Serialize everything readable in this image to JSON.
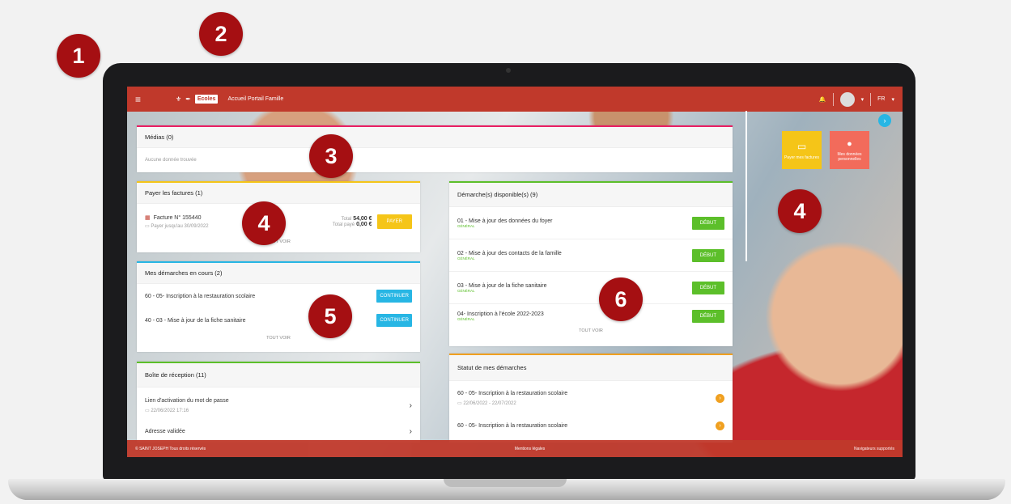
{
  "callouts": [
    "1",
    "2",
    "3",
    "4",
    "4",
    "5",
    "6"
  ],
  "header": {
    "page_title": "Accueil Portail Famille",
    "logo_text": "Ecoles",
    "lang": "FR",
    "menu_icon": "≡",
    "bell_icon": "🔔"
  },
  "medias": {
    "title": "Médias (0)",
    "empty": "Aucune donnée trouvée"
  },
  "factures": {
    "title": "Payer les factures (1)",
    "invoice": "Facture N° 155440",
    "due_label": "Payer jusqu'au",
    "due_date": "30/09/2022",
    "total_label": "Total",
    "total": "54,00 €",
    "paid_label": "Total payé",
    "paid": "0,00 €",
    "pay_button": "PAYER",
    "see_all": "TOUT VOIR"
  },
  "demarches_en_cours": {
    "title": "Mes démarches en cours (2)",
    "items": [
      {
        "label": "60 - 05- Inscription à la restauration scolaire",
        "button": "CONTINUER"
      },
      {
        "label": "40 - 03 - Mise à jour de la fiche sanitaire",
        "button": "CONTINUER"
      }
    ],
    "see_all": "TOUT VOIR"
  },
  "boite": {
    "title": "Boîte de réception",
    "count": "(11)",
    "items": [
      {
        "label": "Lien d'activation du mot de passe",
        "date": "22/06/2022 17:16"
      },
      {
        "label": "Adresse validée"
      }
    ]
  },
  "disponibles": {
    "title": "Démarche(s) disponible(s) (9)",
    "items": [
      {
        "label": "01 - Mise à jour des données du foyer",
        "tag": "GÉNÉRAL",
        "button": "DÉBUT"
      },
      {
        "label": "02 - Mise à jour des contacts de la famille",
        "tag": "GÉNÉRAL",
        "button": "DÉBUT"
      },
      {
        "label": "03 - Mise à jour de la fiche sanitaire",
        "tag": "GÉNÉRAL",
        "button": "DÉBUT"
      },
      {
        "label": "04- Inscription à l'école 2022-2023",
        "tag": "GÉNÉRAL",
        "button": "DÉBUT"
      }
    ],
    "see_all": "TOUT VOIR"
  },
  "statut": {
    "title": "Statut de mes démarches",
    "items": [
      {
        "label": "60 - 05- Inscription à la restauration scolaire",
        "date": "22/06/2022 - 22/07/2022"
      },
      {
        "label": "60 - 05- Inscription à la restauration scolaire"
      }
    ]
  },
  "tiles": {
    "pay": "Payer mes factures",
    "data": "Mes données personnelles"
  },
  "footer": {
    "left": "© SAINT JOSEPH Tous droits réservés",
    "center": "Mentions légales",
    "right": "Navigateurs supportés"
  },
  "colors": {
    "brand": "#c0392b",
    "callout": "#a50f12",
    "green": "#5cbf2a",
    "blue": "#27b6e4",
    "yellow": "#f5c518",
    "orange": "#f0a020"
  }
}
